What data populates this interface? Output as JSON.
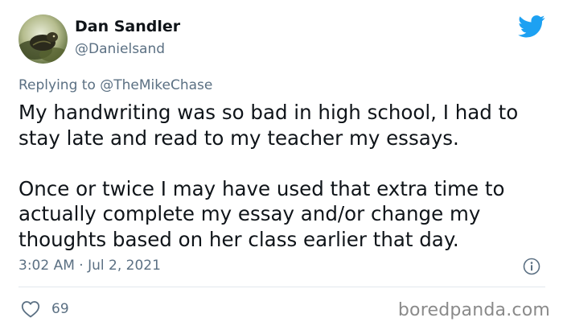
{
  "author": {
    "display_name": "Dan Sandler",
    "handle": "@Danielsand"
  },
  "reply": {
    "prefix": "Replying to ",
    "mention": "@TheMikeChase"
  },
  "tweet": {
    "paragraphs": [
      "My handwriting was so bad in high school, I had to stay late and read to my teacher my essays.",
      "Once or twice I may have used that extra time to actually complete my essay and/or change my thoughts based on her class earlier that day."
    ],
    "timestamp": "3:02 AM · Jul 2, 2021"
  },
  "stats": {
    "likes": "69"
  },
  "watermark": "boredpanda.com",
  "colors": {
    "twitter_blue": "#1da1f2",
    "secondary_text": "#5b7083",
    "primary_text": "#0f1419",
    "divider": "#e1e8ed"
  },
  "icons": {
    "brand": "twitter-bird-icon",
    "info": "info-icon",
    "like": "heart-icon"
  }
}
